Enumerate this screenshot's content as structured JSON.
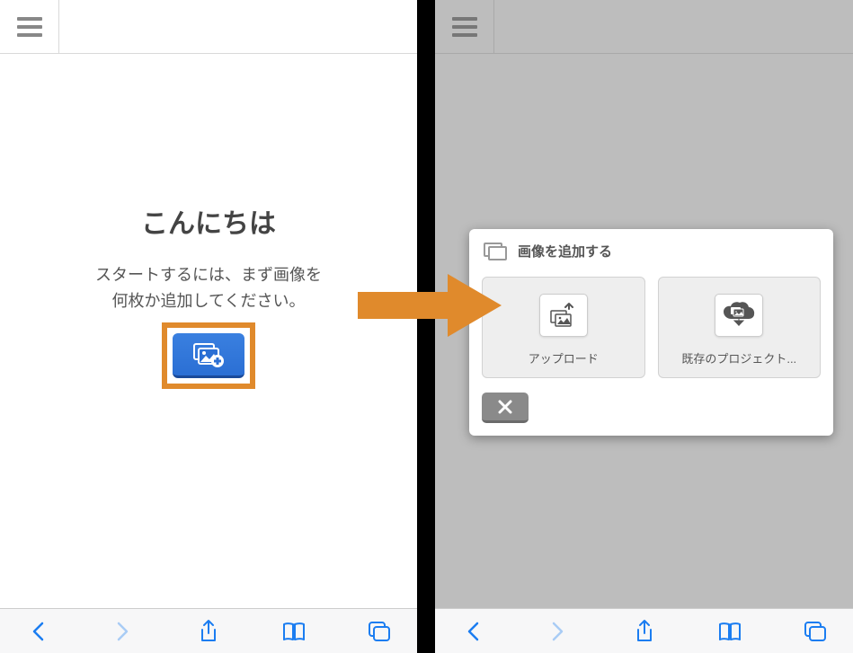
{
  "left": {
    "greeting": "こんにちは",
    "instruction_line1": "スタートするには、まず画像を",
    "instruction_line2": "何枚か追加してください。"
  },
  "dialog": {
    "title": "画像を追加する",
    "upload_label": "アップロード",
    "existing_label": "既存のプロジェクト..."
  }
}
